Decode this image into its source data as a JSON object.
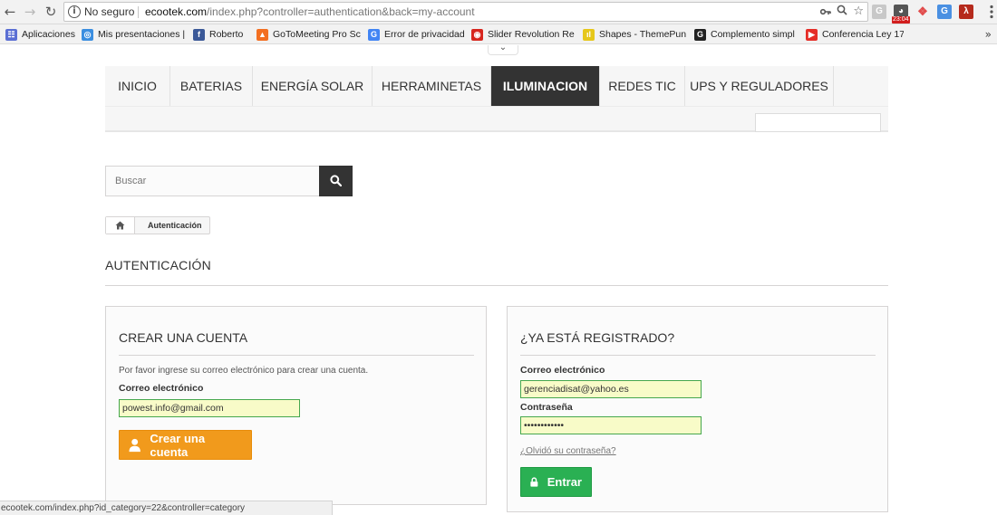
{
  "browser": {
    "security_label": "No seguro",
    "url_host": "ecootek.com",
    "url_path": "/index.php?controller=authentication&back=my-account",
    "clock_badge": "23:04"
  },
  "bookmarks": [
    {
      "label": "Aplicaciones",
      "icon": "apps-grid-icon",
      "color": "#5b6fd4"
    },
    {
      "label": "Mis presentaciones |",
      "icon": "presentations-icon",
      "color": "#3b8ee0"
    },
    {
      "label": "Roberto",
      "icon": "facebook-icon",
      "color": "#3b5998"
    },
    {
      "label": "GoToMeeting Pro Sc",
      "icon": "gotomeeting-icon",
      "color": "#f36f21"
    },
    {
      "label": "Error de privacidad",
      "icon": "google-icon",
      "color": "#4285f4"
    },
    {
      "label": "Slider Revolution Re",
      "icon": "slider-revolution-icon",
      "color": "#d7261e"
    },
    {
      "label": "Shapes - ThemePun",
      "icon": "shapes-icon",
      "color": "#e6c71a"
    },
    {
      "label": "Complemento simpl",
      "icon": "g-circle-icon",
      "color": "#222222"
    },
    {
      "label": "Conferencia Ley 171",
      "icon": "youtube-icon",
      "color": "#e52d27"
    }
  ],
  "menu": {
    "items": [
      "INICIO",
      "BATERIAS",
      "ENERGÍA SOLAR",
      "HERRAMINETAS",
      "ILUMINACION",
      "REDES TIC",
      "UPS Y REGULADORES"
    ],
    "active": "ILUMINACION"
  },
  "search": {
    "placeholder": "Buscar"
  },
  "breadcrumb": {
    "current": "Autenticación"
  },
  "page": {
    "heading": "AUTENTICACIÓN"
  },
  "create_account": {
    "title": "CREAR UNA CUENTA",
    "instructions": "Por favor ingrese su correo electrónico para crear una cuenta.",
    "email_label": "Correo electrónico",
    "email_value": "powest.info@gmail.com",
    "button_label": "Crear una cuenta"
  },
  "login": {
    "title": "¿YA ESTÁ REGISTRADO?",
    "email_label": "Correo electrónico",
    "email_value": "gerenciadisat@yahoo.es",
    "password_label": "Contraseña",
    "password_value": "••••••••••••",
    "forgot_label": "¿Olvidó su contraseña?",
    "button_label": "Entrar"
  },
  "colors": {
    "menu_active_bg": "#333333",
    "create_button": "#f19a1c",
    "enter_button": "#2ab053",
    "autofill_field": "#f8fbc8",
    "field_border": "#46a74e"
  },
  "status_bar": {
    "text": "ecootek.com/index.php?id_category=22&controller=category"
  }
}
